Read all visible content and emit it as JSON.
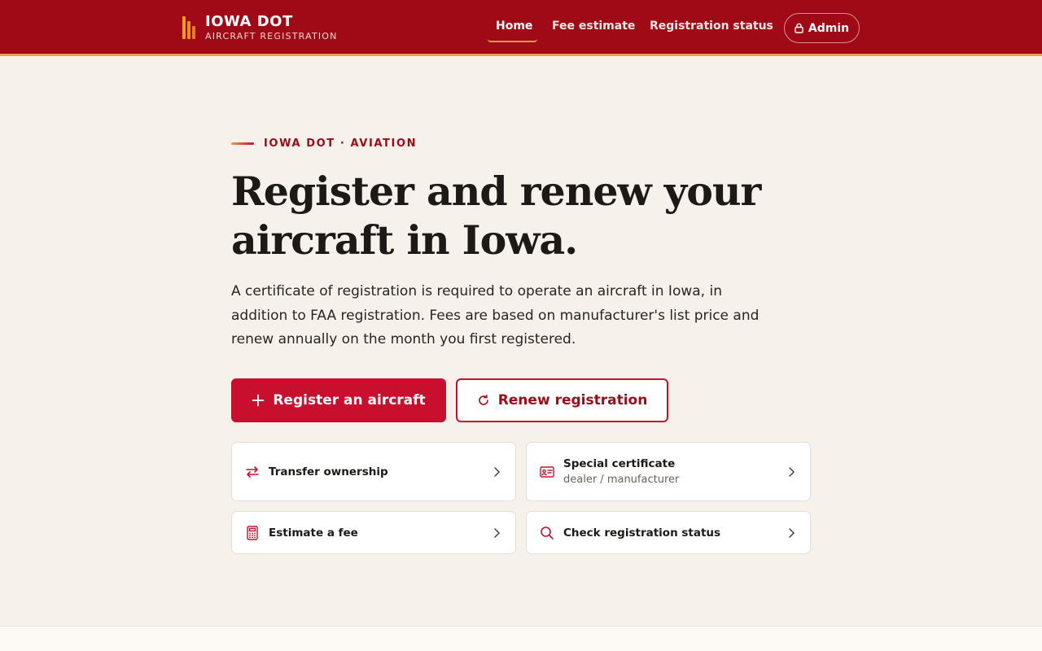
{
  "brand": {
    "title": "IOWA DOT",
    "subtitle": "AIRCRAFT REGISTRATION",
    "primary_color": "#a00a17",
    "accent_color": "#f2994a"
  },
  "nav": {
    "home": "Home",
    "fee_estimate": "Fee estimate",
    "registration_status": "Registration status",
    "admin": "Admin",
    "active": "Home"
  },
  "hero": {
    "eyebrow": "IOWA DOT · AVIATION",
    "title_line1": "Register and renew your",
    "title_line2": "aircraft in Iowa.",
    "lead": "A certificate of registration is required to operate an aircraft in Iowa, in addition to FAA registration. Fees are based on manufacturer's list price and renew annually on the month you first registered."
  },
  "actions": {
    "register": "Register an aircraft",
    "renew": "Renew registration"
  },
  "cards": [
    {
      "title": "Transfer ownership",
      "subtitle": "",
      "icon": "swap-arrows-icon"
    },
    {
      "title": "Special certificate",
      "subtitle": "dealer / manufacturer",
      "icon": "id-card-icon"
    },
    {
      "title": "Estimate a fee",
      "subtitle": "",
      "icon": "calculator-icon"
    },
    {
      "title": "Check registration status",
      "subtitle": "",
      "icon": "search-icon"
    }
  ]
}
